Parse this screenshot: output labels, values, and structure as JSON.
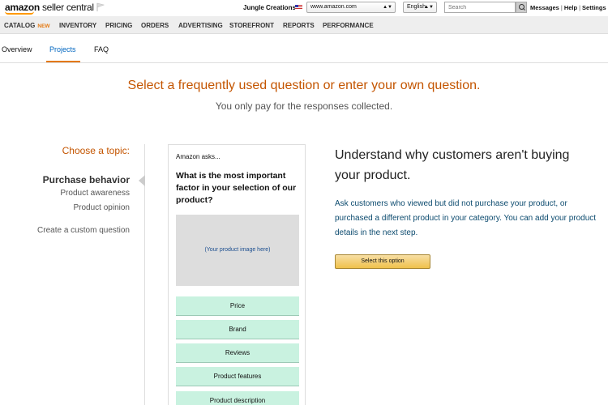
{
  "header": {
    "logo_main": "amazon",
    "logo_sub": "seller central",
    "store_name": "Jungle Creations",
    "marketplace": "www.amazon.com",
    "language": "English",
    "search_placeholder": "Search",
    "links": [
      "Messages",
      "Help",
      "Settings"
    ],
    "separator": "|"
  },
  "nav": {
    "items": [
      "CATALOG",
      "INVENTORY",
      "PRICING",
      "ORDERS",
      "ADVERTISING",
      "STOREFRONT",
      "REPORTS",
      "PERFORMANCE"
    ],
    "new_badge": "NEW"
  },
  "tabs": [
    "Overview",
    "Projects",
    "FAQ"
  ],
  "active_tab": "Projects",
  "headline": "Select a frequently used question or enter your own question.",
  "subhead": "You only pay for the responses collected.",
  "topics": {
    "heading": "Choose a topic:",
    "active": "Purchase behavior",
    "items": [
      "Product awareness",
      "Product opinion"
    ],
    "custom": "Create a custom question"
  },
  "preview": {
    "label": "Amazon asks...",
    "question": "What is the most important factor in your selection of our product?",
    "image_text": "(Your product image here)",
    "options": [
      "Price",
      "Brand",
      "Reviews",
      "Product features",
      "Product description"
    ]
  },
  "panel": {
    "title": "Understand why customers aren't buying your product.",
    "description": "Ask customers who viewed but did not purchase your product, or purchased a different product in your category. You can add your product details in the next step.",
    "button": "Select this option"
  },
  "colors": {
    "accent_orange": "#c45500",
    "link_blue": "#0066c0",
    "option_green": "#c9f2e0",
    "button_gold": "#f0c14b"
  }
}
